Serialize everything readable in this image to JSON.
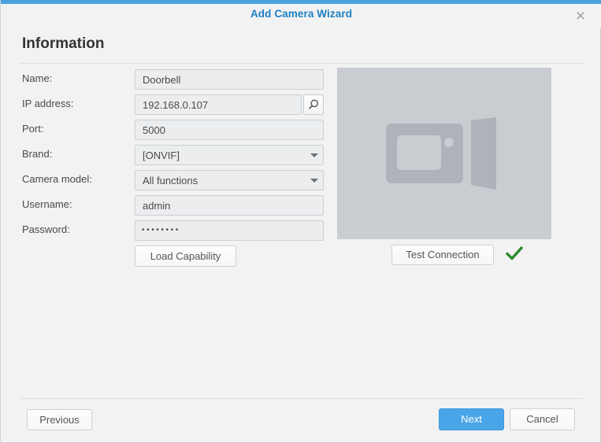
{
  "window": {
    "title": "Add Camera Wizard",
    "close_label": "✕",
    "accent_color": "#4aa3dd",
    "title_color": "#1c7fc4"
  },
  "page": {
    "heading": "Information"
  },
  "form": {
    "fields": [
      {
        "label": "Name:",
        "value": "Doorbell",
        "type": "text"
      },
      {
        "label": "IP address:",
        "value": "192.168.0.107",
        "type": "text-with-search"
      },
      {
        "label": "Port:",
        "value": "5000",
        "type": "text"
      },
      {
        "label": "Brand:",
        "value": "[ONVIF]",
        "type": "select"
      },
      {
        "label": "Camera model:",
        "value": "All functions",
        "type": "select"
      },
      {
        "label": "Username:",
        "value": "admin",
        "type": "text"
      },
      {
        "label": "Password:",
        "value": "••••••••",
        "type": "password"
      }
    ],
    "load_capability_label": "Load Capability",
    "search_icon": "magnifier-icon"
  },
  "preview": {
    "placeholder_icon": "video-camera-icon",
    "background_color": "#c9cdd2"
  },
  "connection": {
    "test_label": "Test Connection",
    "status_icon": "checkmark-icon",
    "status_color": "#2d8a2d"
  },
  "footer": {
    "previous_label": "Previous",
    "next_label": "Next",
    "cancel_label": "Cancel",
    "next_color": "#4aa5e8"
  }
}
